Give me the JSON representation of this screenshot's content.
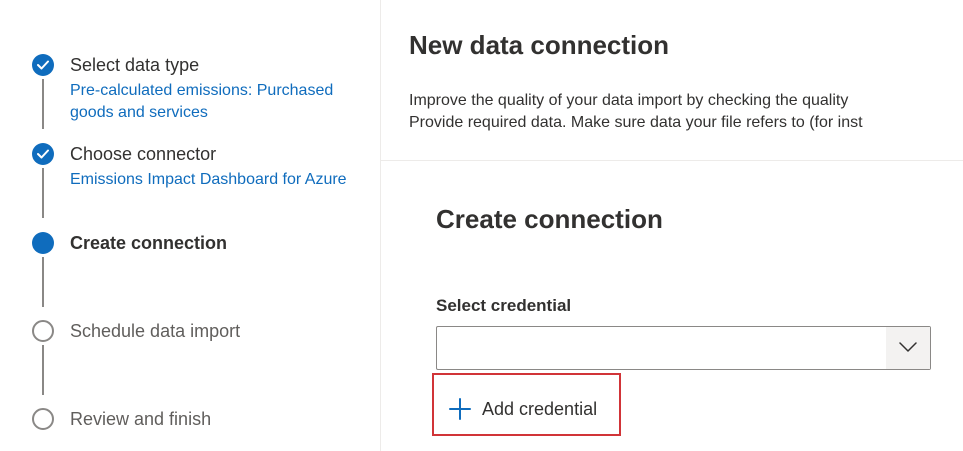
{
  "stepper": {
    "steps": [
      {
        "title": "Select data type",
        "subtitle": "Pre-calculated emissions: Purchased goods and services",
        "state": "done"
      },
      {
        "title": "Choose connector",
        "subtitle": "Emissions Impact Dashboard for Azure",
        "state": "done"
      },
      {
        "title": "Create connection",
        "subtitle": "",
        "state": "current"
      },
      {
        "title": "Schedule data import",
        "subtitle": "",
        "state": "pending"
      },
      {
        "title": "Review and finish",
        "subtitle": "",
        "state": "pending"
      }
    ]
  },
  "header": {
    "title": "New data connection",
    "description_line1": "Improve the quality of your data import by checking the quality",
    "description_line2": "Provide required data. Make sure data your file refers to (for inst"
  },
  "form": {
    "section_title": "Create connection",
    "credential_label": "Select credential",
    "credential_value": "",
    "add_credential_label": "Add credential"
  },
  "icons": {
    "check": "checkmark-icon",
    "dropdown": "chevron-down-icon",
    "add": "plus-icon"
  },
  "colors": {
    "accent": "#0f6cbd",
    "highlight": "#d13438",
    "pending": "#8a8886"
  }
}
